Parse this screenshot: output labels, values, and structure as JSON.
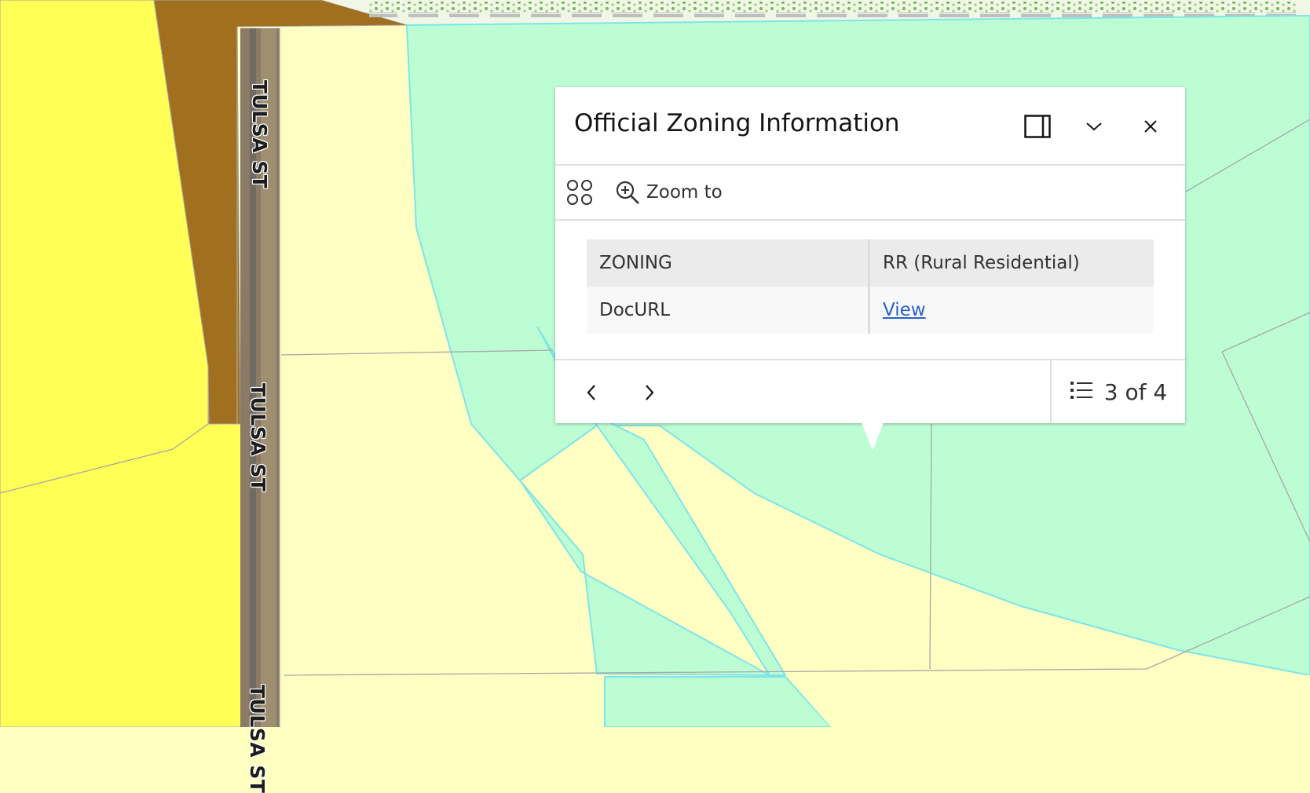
{
  "map": {
    "road_labels": [
      "TULSA ST",
      "TULSA ST",
      "TULSA ST"
    ],
    "zone_colors": {
      "commercial": "#ffff55",
      "industrial": "#a0701f",
      "residential_light": "#ffffc3",
      "rural_residential": "#bdfdd4",
      "boundary": "#7de5e8",
      "parcel_line": "#a7a7a7"
    }
  },
  "popup": {
    "title": "Official Zoning Information",
    "dock_label": "Dock",
    "collapse_label": "Collapse",
    "close_label": "Close",
    "actions": {
      "zoom_label": "Zoom to"
    },
    "attributes": [
      {
        "field": "ZONING",
        "value": "RR (Rural Residential)"
      },
      {
        "field": "DocURL",
        "value": "View"
      }
    ],
    "footer": {
      "feature_count": "3 of 4"
    }
  }
}
